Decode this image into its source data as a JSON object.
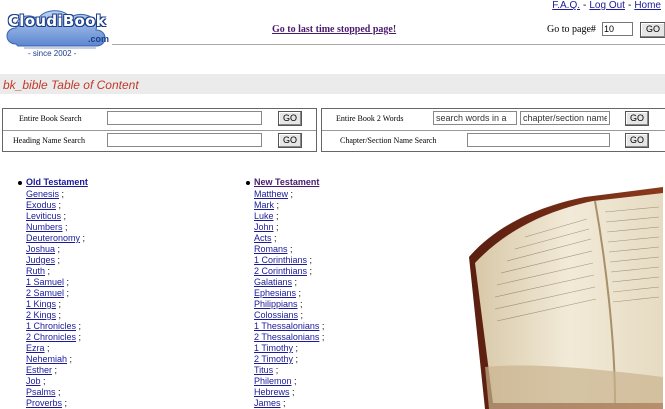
{
  "logo": {
    "name": "CloudiBook",
    "domain": ".com",
    "since": "- since 2002 -"
  },
  "top_links": [
    {
      "label": "F.A.Q."
    },
    {
      "label": "Log Out"
    },
    {
      "label": "Home"
    }
  ],
  "last_page_link": "Go to last time stopped page!",
  "goto": {
    "label": "Go to page#",
    "value": "10",
    "button": "GO"
  },
  "page_title": "bk_bible Table of Content",
  "search": {
    "entire_book": {
      "label": "Entire Book Search",
      "value": "",
      "button": "GO"
    },
    "heading_name": {
      "label": "Heading Name Search",
      "value": "",
      "button": "GO"
    },
    "entire_book_2_words": {
      "label": "Entire Book 2 Words",
      "value1": "search words in a",
      "value2": "chapter/section name",
      "button": "GO"
    },
    "chapter_section_name": {
      "label": "Chapter/Section Name Search",
      "value": "",
      "button": "GO"
    }
  },
  "old_testament": {
    "heading": "Old Testament",
    "books": [
      "Genesis",
      "Exodus",
      "Leviticus",
      "Numbers",
      "Deuteronomy",
      "Joshua",
      "Judges",
      "Ruth",
      "1 Samuel",
      "2 Samuel",
      "1 Kings",
      "2 Kings",
      "1 Chronicles",
      "2 Chronicles",
      "Ezra",
      "Nehemiah",
      "Esther",
      "Job",
      "Psalms",
      "Proverbs"
    ]
  },
  "new_testament": {
    "heading": "New Testament",
    "books": [
      "Matthew",
      "Mark",
      "Luke",
      "John",
      "Acts",
      "Romans",
      "1 Corinthians",
      "2 Corinthians",
      "Galatians",
      "Ephesians",
      "Philippians",
      "Colossians",
      "1 Thessalonians",
      "2 Thessalonians",
      "1 Timothy",
      "2 Timothy",
      "Titus",
      "Philemon",
      "Hebrews",
      "James"
    ]
  },
  "separator": ";",
  "colors": {
    "link": "#1a1a9a",
    "title_red": "#c23a2a",
    "visited": "#4b1a6e",
    "logo_blue": "#1b3d8a"
  },
  "icons": {
    "bible_image": "open-bible-image"
  }
}
